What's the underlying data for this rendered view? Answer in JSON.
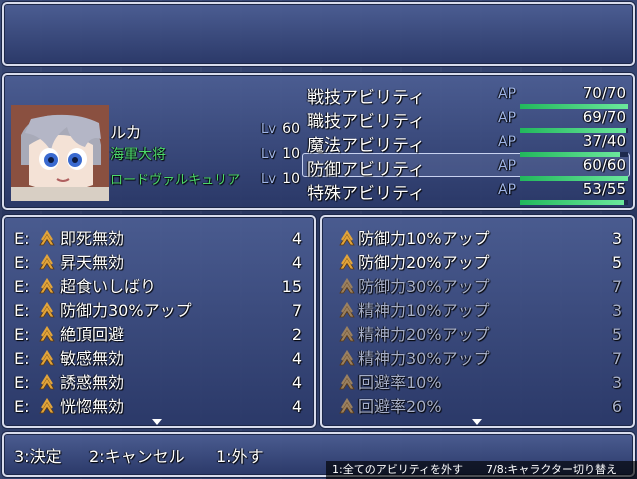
{
  "character": {
    "name": "ルカ",
    "class_primary": "海軍大将",
    "class_secondary": "ロードヴァルキュリア",
    "lv_label": "Lv",
    "level": "60",
    "class_primary_level": "10",
    "class_secondary_level": "10"
  },
  "abilities": [
    {
      "label": "戦技アビリティ",
      "ap_label": "AP",
      "ap": "70/70",
      "fill": 1.0
    },
    {
      "label": "職技アビリティ",
      "ap_label": "AP",
      "ap": "69/70",
      "fill": 0.986
    },
    {
      "label": "魔法アビリティ",
      "ap_label": "AP",
      "ap": "37/40",
      "fill": 0.925
    },
    {
      "label": "防御アビリティ",
      "ap_label": "AP",
      "ap": "60/60",
      "fill": 1.0,
      "selected": true
    },
    {
      "label": "特殊アビリティ",
      "ap_label": "AP",
      "ap": "53/55",
      "fill": 0.964
    }
  ],
  "equipped_prefix": "E:",
  "equipped": [
    {
      "label": "即死無効",
      "cost": "4"
    },
    {
      "label": "昇天無効",
      "cost": "4"
    },
    {
      "label": "超食いしばり",
      "cost": "15"
    },
    {
      "label": "防御力30%アップ",
      "cost": "7"
    },
    {
      "label": "絶頂回避",
      "cost": "2"
    },
    {
      "label": "敏感無効",
      "cost": "4"
    },
    {
      "label": "誘惑無効",
      "cost": "4"
    },
    {
      "label": "恍惚無効",
      "cost": "4"
    }
  ],
  "available": [
    {
      "label": "防御力10%アップ",
      "cost": "3",
      "enabled": true
    },
    {
      "label": "防御力20%アップ",
      "cost": "5",
      "enabled": true
    },
    {
      "label": "防御力30%アップ",
      "cost": "7",
      "enabled": false
    },
    {
      "label": "精神力10%アップ",
      "cost": "3",
      "enabled": false
    },
    {
      "label": "精神力20%アップ",
      "cost": "5",
      "enabled": false
    },
    {
      "label": "精神力30%アップ",
      "cost": "7",
      "enabled": false
    },
    {
      "label": "回避率10%",
      "cost": "3",
      "enabled": false
    },
    {
      "label": "回避率20%",
      "cost": "6",
      "enabled": false
    }
  ],
  "help": {
    "confirm": "3:決定",
    "cancel": "2:キャンセル",
    "remove": "1:外す"
  },
  "footer": {
    "remove_all": "1:全てのアビリティを外す",
    "switch_char": "7/8:キャラクター切り替え"
  },
  "colors": {
    "class_primary": "#4cd86a",
    "ap_bar": "#22b85c",
    "icon": "#e2a43a"
  },
  "icons": {
    "ability": "chevron-up-icon",
    "scroll": "arrow-down-icon"
  }
}
